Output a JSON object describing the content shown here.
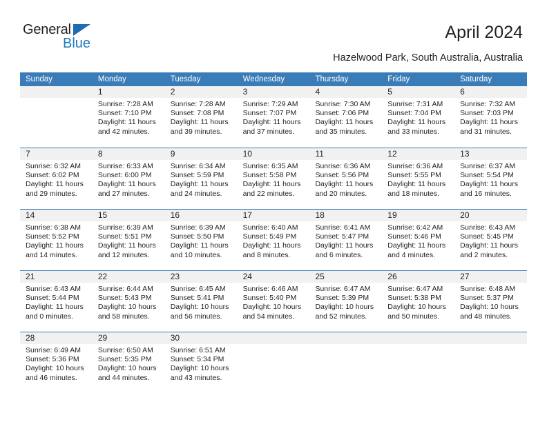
{
  "brand": {
    "name_top": "General",
    "name_bottom": "Blue",
    "accent_color": "#1f7ac0",
    "triangle_color": "#1f6cb4"
  },
  "header": {
    "title": "April 2024",
    "subtitle": "Hazelwood Park, South Australia, Australia"
  },
  "calendar": {
    "header_bg": "#3a7cb8",
    "day_band_bg": "#f1f1f1",
    "weekdays": [
      "Sunday",
      "Monday",
      "Tuesday",
      "Wednesday",
      "Thursday",
      "Friday",
      "Saturday"
    ],
    "weeks": [
      [
        {
          "date": "",
          "sunrise": "",
          "sunset": "",
          "daylight": "",
          "daylight2": ""
        },
        {
          "date": "1",
          "sunrise": "Sunrise: 7:28 AM",
          "sunset": "Sunset: 7:10 PM",
          "daylight": "Daylight: 11 hours",
          "daylight2": "and 42 minutes."
        },
        {
          "date": "2",
          "sunrise": "Sunrise: 7:28 AM",
          "sunset": "Sunset: 7:08 PM",
          "daylight": "Daylight: 11 hours",
          "daylight2": "and 39 minutes."
        },
        {
          "date": "3",
          "sunrise": "Sunrise: 7:29 AM",
          "sunset": "Sunset: 7:07 PM",
          "daylight": "Daylight: 11 hours",
          "daylight2": "and 37 minutes."
        },
        {
          "date": "4",
          "sunrise": "Sunrise: 7:30 AM",
          "sunset": "Sunset: 7:06 PM",
          "daylight": "Daylight: 11 hours",
          "daylight2": "and 35 minutes."
        },
        {
          "date": "5",
          "sunrise": "Sunrise: 7:31 AM",
          "sunset": "Sunset: 7:04 PM",
          "daylight": "Daylight: 11 hours",
          "daylight2": "and 33 minutes."
        },
        {
          "date": "6",
          "sunrise": "Sunrise: 7:32 AM",
          "sunset": "Sunset: 7:03 PM",
          "daylight": "Daylight: 11 hours",
          "daylight2": "and 31 minutes."
        }
      ],
      [
        {
          "date": "7",
          "sunrise": "Sunrise: 6:32 AM",
          "sunset": "Sunset: 6:02 PM",
          "daylight": "Daylight: 11 hours",
          "daylight2": "and 29 minutes."
        },
        {
          "date": "8",
          "sunrise": "Sunrise: 6:33 AM",
          "sunset": "Sunset: 6:00 PM",
          "daylight": "Daylight: 11 hours",
          "daylight2": "and 27 minutes."
        },
        {
          "date": "9",
          "sunrise": "Sunrise: 6:34 AM",
          "sunset": "Sunset: 5:59 PM",
          "daylight": "Daylight: 11 hours",
          "daylight2": "and 24 minutes."
        },
        {
          "date": "10",
          "sunrise": "Sunrise: 6:35 AM",
          "sunset": "Sunset: 5:58 PM",
          "daylight": "Daylight: 11 hours",
          "daylight2": "and 22 minutes."
        },
        {
          "date": "11",
          "sunrise": "Sunrise: 6:36 AM",
          "sunset": "Sunset: 5:56 PM",
          "daylight": "Daylight: 11 hours",
          "daylight2": "and 20 minutes."
        },
        {
          "date": "12",
          "sunrise": "Sunrise: 6:36 AM",
          "sunset": "Sunset: 5:55 PM",
          "daylight": "Daylight: 11 hours",
          "daylight2": "and 18 minutes."
        },
        {
          "date": "13",
          "sunrise": "Sunrise: 6:37 AM",
          "sunset": "Sunset: 5:54 PM",
          "daylight": "Daylight: 11 hours",
          "daylight2": "and 16 minutes."
        }
      ],
      [
        {
          "date": "14",
          "sunrise": "Sunrise: 6:38 AM",
          "sunset": "Sunset: 5:52 PM",
          "daylight": "Daylight: 11 hours",
          "daylight2": "and 14 minutes."
        },
        {
          "date": "15",
          "sunrise": "Sunrise: 6:39 AM",
          "sunset": "Sunset: 5:51 PM",
          "daylight": "Daylight: 11 hours",
          "daylight2": "and 12 minutes."
        },
        {
          "date": "16",
          "sunrise": "Sunrise: 6:39 AM",
          "sunset": "Sunset: 5:50 PM",
          "daylight": "Daylight: 11 hours",
          "daylight2": "and 10 minutes."
        },
        {
          "date": "17",
          "sunrise": "Sunrise: 6:40 AM",
          "sunset": "Sunset: 5:49 PM",
          "daylight": "Daylight: 11 hours",
          "daylight2": "and 8 minutes."
        },
        {
          "date": "18",
          "sunrise": "Sunrise: 6:41 AM",
          "sunset": "Sunset: 5:47 PM",
          "daylight": "Daylight: 11 hours",
          "daylight2": "and 6 minutes."
        },
        {
          "date": "19",
          "sunrise": "Sunrise: 6:42 AM",
          "sunset": "Sunset: 5:46 PM",
          "daylight": "Daylight: 11 hours",
          "daylight2": "and 4 minutes."
        },
        {
          "date": "20",
          "sunrise": "Sunrise: 6:43 AM",
          "sunset": "Sunset: 5:45 PM",
          "daylight": "Daylight: 11 hours",
          "daylight2": "and 2 minutes."
        }
      ],
      [
        {
          "date": "21",
          "sunrise": "Sunrise: 6:43 AM",
          "sunset": "Sunset: 5:44 PM",
          "daylight": "Daylight: 11 hours",
          "daylight2": "and 0 minutes."
        },
        {
          "date": "22",
          "sunrise": "Sunrise: 6:44 AM",
          "sunset": "Sunset: 5:43 PM",
          "daylight": "Daylight: 10 hours",
          "daylight2": "and 58 minutes."
        },
        {
          "date": "23",
          "sunrise": "Sunrise: 6:45 AM",
          "sunset": "Sunset: 5:41 PM",
          "daylight": "Daylight: 10 hours",
          "daylight2": "and 56 minutes."
        },
        {
          "date": "24",
          "sunrise": "Sunrise: 6:46 AM",
          "sunset": "Sunset: 5:40 PM",
          "daylight": "Daylight: 10 hours",
          "daylight2": "and 54 minutes."
        },
        {
          "date": "25",
          "sunrise": "Sunrise: 6:47 AM",
          "sunset": "Sunset: 5:39 PM",
          "daylight": "Daylight: 10 hours",
          "daylight2": "and 52 minutes."
        },
        {
          "date": "26",
          "sunrise": "Sunrise: 6:47 AM",
          "sunset": "Sunset: 5:38 PM",
          "daylight": "Daylight: 10 hours",
          "daylight2": "and 50 minutes."
        },
        {
          "date": "27",
          "sunrise": "Sunrise: 6:48 AM",
          "sunset": "Sunset: 5:37 PM",
          "daylight": "Daylight: 10 hours",
          "daylight2": "and 48 minutes."
        }
      ],
      [
        {
          "date": "28",
          "sunrise": "Sunrise: 6:49 AM",
          "sunset": "Sunset: 5:36 PM",
          "daylight": "Daylight: 10 hours",
          "daylight2": "and 46 minutes."
        },
        {
          "date": "29",
          "sunrise": "Sunrise: 6:50 AM",
          "sunset": "Sunset: 5:35 PM",
          "daylight": "Daylight: 10 hours",
          "daylight2": "and 44 minutes."
        },
        {
          "date": "30",
          "sunrise": "Sunrise: 6:51 AM",
          "sunset": "Sunset: 5:34 PM",
          "daylight": "Daylight: 10 hours",
          "daylight2": "and 43 minutes."
        },
        {
          "date": "",
          "sunrise": "",
          "sunset": "",
          "daylight": "",
          "daylight2": ""
        },
        {
          "date": "",
          "sunrise": "",
          "sunset": "",
          "daylight": "",
          "daylight2": ""
        },
        {
          "date": "",
          "sunrise": "",
          "sunset": "",
          "daylight": "",
          "daylight2": ""
        },
        {
          "date": "",
          "sunrise": "",
          "sunset": "",
          "daylight": "",
          "daylight2": ""
        }
      ]
    ]
  }
}
